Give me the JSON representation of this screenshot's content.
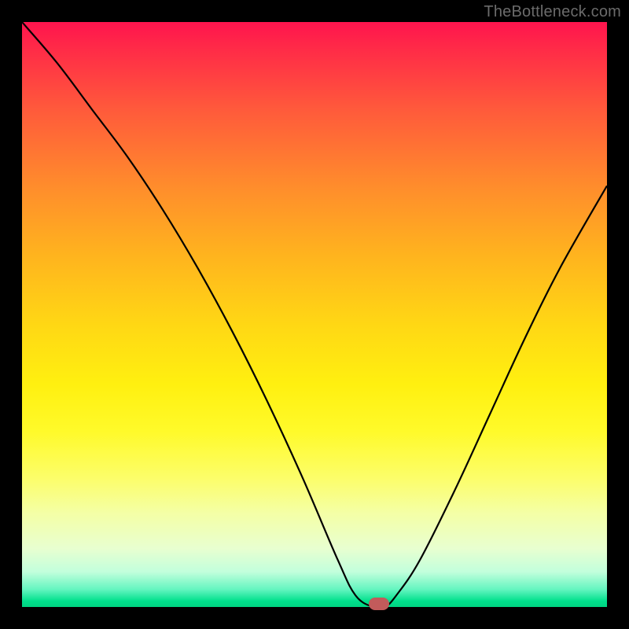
{
  "brand": {
    "watermark": "TheBottleneck.com"
  },
  "chart_data": {
    "type": "line",
    "title": "",
    "xlabel": "",
    "ylabel": "",
    "xlim": [
      0,
      100
    ],
    "ylim": [
      0,
      100
    ],
    "grid": false,
    "legend": false,
    "background": "vertical-gradient red→yellow→green (top→bottom)",
    "series": [
      {
        "name": "bottleneck-curve",
        "x": [
          0,
          6,
          12,
          18,
          24,
          30,
          36,
          42,
          48,
          54,
          57,
          60,
          62,
          64,
          68,
          74,
          80,
          86,
          92,
          100
        ],
        "y": [
          100,
          93,
          85,
          77,
          68,
          58,
          47,
          35,
          22,
          8,
          2,
          0,
          0,
          2,
          8,
          20,
          33,
          46,
          58,
          72
        ]
      }
    ],
    "annotations": [
      {
        "name": "min-marker",
        "x": 61,
        "y": 0.5,
        "shape": "pill",
        "color": "#c25b5b"
      }
    ],
    "gradient_stops": [
      {
        "pct": 0,
        "color": "#ff144e"
      },
      {
        "pct": 50,
        "color": "#ffe010"
      },
      {
        "pct": 100,
        "color": "#00d482"
      }
    ]
  }
}
